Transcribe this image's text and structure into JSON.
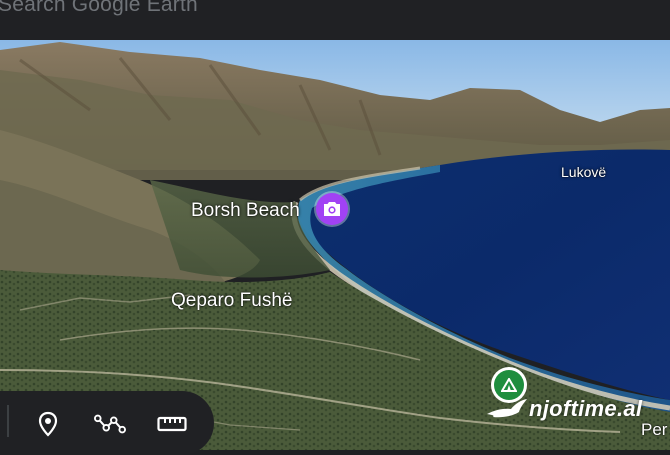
{
  "search": {
    "placeholder": "Search Google Earth"
  },
  "map": {
    "labels": {
      "borsh_beach": "Borsh Beach",
      "qeparo_fushe": "Qeparo Fushë",
      "lukove": "Lukovë",
      "per": "Per"
    },
    "pins": {
      "camera": {
        "icon": "camera-icon",
        "color": "#a142f4"
      },
      "camping": {
        "icon": "camping-tent-icon",
        "color": "#1e8e3e"
      }
    }
  },
  "toolbar": {
    "items": [
      {
        "name": "add-placemark",
        "icon": "location-pin-icon"
      },
      {
        "name": "draw-path",
        "icon": "path-icon"
      },
      {
        "name": "measure",
        "icon": "ruler-icon"
      }
    ]
  },
  "watermark": {
    "text": "njoftime.al",
    "logo": "bird-logo"
  }
}
